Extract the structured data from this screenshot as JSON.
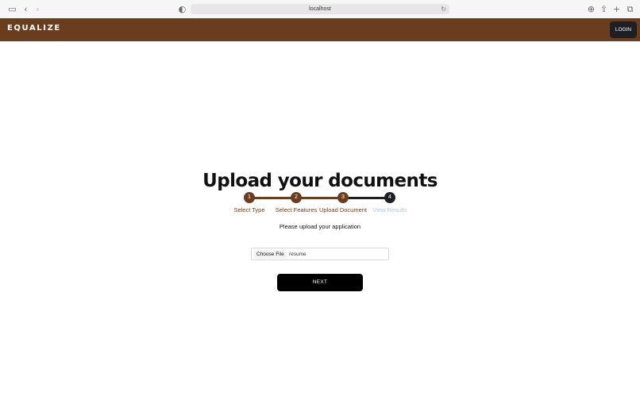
{
  "browser": {
    "address": "localhost",
    "icons": [
      "sidebar-icon",
      "back-icon",
      "forward-icon",
      "reader-icon",
      "reload-icon",
      "download-icon",
      "share-icon",
      "new-tab-icon",
      "tabs-overview-icon"
    ]
  },
  "header": {
    "logo": "EQUALIZE",
    "login_label": "LOGIN",
    "bg_color": "#6a3d1e"
  },
  "main": {
    "title": "Upload your documents",
    "steps": [
      {
        "number": "1",
        "label": "Select Type",
        "state": "done"
      },
      {
        "number": "2",
        "label": "Select Features",
        "state": "done"
      },
      {
        "number": "3",
        "label": "Upload Document",
        "state": "current"
      },
      {
        "number": "4",
        "label": "View Results",
        "state": "upcoming"
      }
    ],
    "subtitle": "Please upload your application",
    "file_input": {
      "button_label": "Choose File",
      "file_name": "resume"
    },
    "next_label": "NEXT"
  },
  "colors": {
    "step_done": "#6a3d1e",
    "step_upcoming": "#1e1f24",
    "label_upcoming": "#a9c6e3"
  }
}
